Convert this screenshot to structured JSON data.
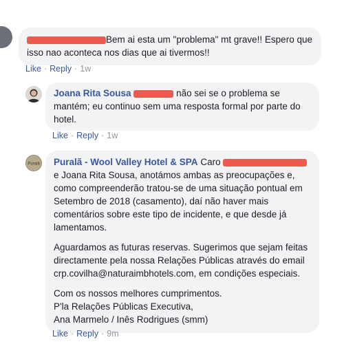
{
  "comment1": {
    "text": "Bem ai esta um \"problema\" mt grave!! Espero que isso nao aconteca nos dias que ai tivermos!!",
    "like_label": "Like",
    "reply_label": "Reply",
    "separator": "·",
    "time": "1w"
  },
  "comment2": {
    "author": "Joana Rita Sousa",
    "text": "não sei se o problema se mantém; eu continuo sem uma resposta formal por parte do hotel.",
    "like_label": "Like",
    "reply_label": "Reply",
    "separator": "·",
    "time": "1w"
  },
  "comment3": {
    "author": "Puralã - Wool Valley Hotel & SPA",
    "avatar_text": "Puralã",
    "greeting": "Caro",
    "paragraph1_rest": "e Joana Rita Sousa, anotámos ambas as preocupações e, como compreenderão tratou-se de uma situação pontual em Setembro de 2018 (casamento), daí não haver mais comentários sobre este tipo de incidente, e que desde já lamentamos.",
    "paragraph2": "Aguardamos as futuras reservas. Sugerimos que sejam feitas directamente pela nossa Relações Públicas através do email crp.covilha@naturaimbhotels.com, em condições especiais.",
    "signature_line1": "Com os nossos melhores cumprimentos.",
    "signature_line2": "P'la Relações Públicas Executiva,",
    "signature_line3": "Ana Marmelo / Inês Rodrigues (smm)",
    "like_label": "Like",
    "reply_label": "Reply",
    "separator": "·",
    "time": "9m"
  },
  "colors": {
    "link": "#385898",
    "bubble": "#f2f3f5",
    "redaction": "#ee5a4e",
    "meta": "#90949c"
  }
}
